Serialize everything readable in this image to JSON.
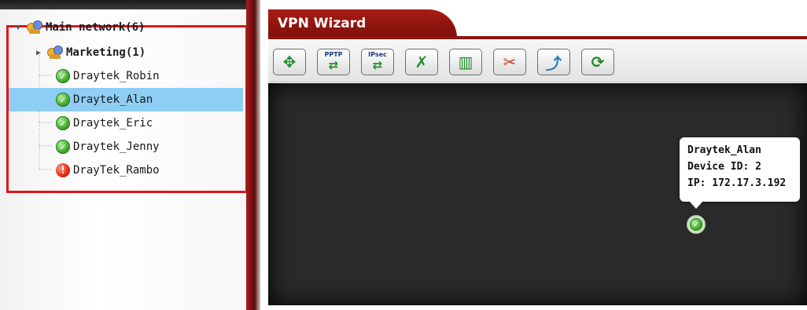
{
  "tree": {
    "root": {
      "label": "Main network(6)"
    },
    "group": {
      "label": "Marketing(1)"
    },
    "devices": [
      {
        "label": "Draytek_Robin",
        "status": "ok"
      },
      {
        "label": "Draytek_Alan",
        "status": "ok",
        "selected": true
      },
      {
        "label": "Draytek_Eric",
        "status": "ok"
      },
      {
        "label": "Draytek_Jenny",
        "status": "ok"
      },
      {
        "label": "DrayTek_Rambo",
        "status": "error"
      }
    ]
  },
  "wizard": {
    "title": "VPN Wizard",
    "toolbar": {
      "move_icon": "move-arrows-icon",
      "pptp_label": "PPTP",
      "ipsec_label": "IPsec",
      "tools_icon": "tools-icon",
      "delete_icon": "trash-icon",
      "cut_icon": "scissors-icon",
      "export_icon": "export-icon",
      "refresh_icon": "refresh-icon"
    },
    "tooltip": {
      "name": "Draytek_Alan",
      "device_id": "Device ID: 2",
      "ip": "IP: 172.17.3.192"
    }
  },
  "colors": {
    "accent_red": "#a81d14",
    "selection_blue": "#8ecdf4",
    "canvas": "#2a2a2a",
    "ok_green": "#3aa626",
    "error_red": "#e02a10"
  }
}
